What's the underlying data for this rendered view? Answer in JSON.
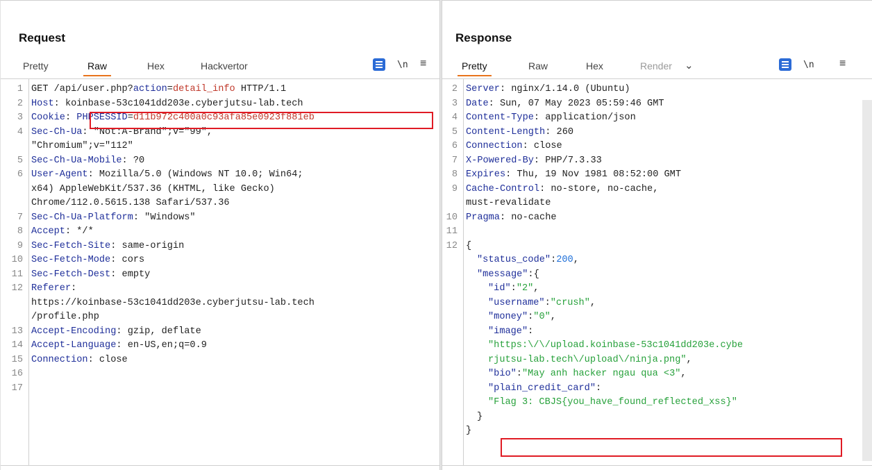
{
  "request": {
    "title": "Request",
    "tabs": [
      "Pretty",
      "Raw",
      "Hex",
      "Hackvertor"
    ],
    "active_tab": "Raw",
    "tool_newline": "\\n",
    "lines": [
      {
        "n": "1",
        "segs": [
          {
            "t": "GET /api/user.php?",
            "c": ""
          },
          {
            "t": "action",
            "c": "key"
          },
          {
            "t": "=",
            "c": ""
          },
          {
            "t": "detail_info",
            "c": "qv"
          },
          {
            "t": " HTTP/1.1",
            "c": ""
          }
        ]
      },
      {
        "n": "2",
        "segs": [
          {
            "t": "Host",
            "c": "key"
          },
          {
            "t": ": koinbase-53c1041dd203e.cyberjutsu-lab.tech",
            "c": ""
          }
        ]
      },
      {
        "n": "3",
        "segs": [
          {
            "t": "Cookie",
            "c": "key"
          },
          {
            "t": ": ",
            "c": ""
          },
          {
            "t": "PHPSESSID",
            "c": "key"
          },
          {
            "t": "=",
            "c": ""
          },
          {
            "t": "d11b972c400a0c93afa85e0923f881eb",
            "c": "qv"
          }
        ]
      },
      {
        "n": "4",
        "segs": [
          {
            "t": "Sec-Ch-Ua",
            "c": "key"
          },
          {
            "t": ": \"Not:A-Brand\";v=\"99\",",
            "c": ""
          }
        ]
      },
      {
        "n": "",
        "segs": [
          {
            "t": "\"Chromium\";v=\"112\"",
            "c": ""
          }
        ]
      },
      {
        "n": "5",
        "segs": [
          {
            "t": "Sec-Ch-Ua-Mobile",
            "c": "key"
          },
          {
            "t": ": ?0",
            "c": ""
          }
        ]
      },
      {
        "n": "6",
        "segs": [
          {
            "t": "User-Agent",
            "c": "key"
          },
          {
            "t": ": Mozilla/5.0 (Windows NT 10.0; Win64;",
            "c": ""
          }
        ]
      },
      {
        "n": "",
        "segs": [
          {
            "t": "x64) AppleWebKit/537.36 (KHTML, like Gecko)",
            "c": ""
          }
        ]
      },
      {
        "n": "",
        "segs": [
          {
            "t": "Chrome/112.0.5615.138 Safari/537.36",
            "c": ""
          }
        ]
      },
      {
        "n": "7",
        "segs": [
          {
            "t": "Sec-Ch-Ua-Platform",
            "c": "key"
          },
          {
            "t": ": \"Windows\"",
            "c": ""
          }
        ]
      },
      {
        "n": "8",
        "segs": [
          {
            "t": "Accept",
            "c": "key"
          },
          {
            "t": ": */*",
            "c": ""
          }
        ]
      },
      {
        "n": "9",
        "segs": [
          {
            "t": "Sec-Fetch-Site",
            "c": "key"
          },
          {
            "t": ": same-origin",
            "c": ""
          }
        ]
      },
      {
        "n": "10",
        "segs": [
          {
            "t": "Sec-Fetch-Mode",
            "c": "key"
          },
          {
            "t": ": cors",
            "c": ""
          }
        ]
      },
      {
        "n": "11",
        "segs": [
          {
            "t": "Sec-Fetch-Dest",
            "c": "key"
          },
          {
            "t": ": empty",
            "c": ""
          }
        ]
      },
      {
        "n": "12",
        "segs": [
          {
            "t": "Referer",
            "c": "key"
          },
          {
            "t": ":",
            "c": ""
          }
        ]
      },
      {
        "n": "",
        "segs": [
          {
            "t": "https://koinbase-53c1041dd203e.cyberjutsu-lab.tech",
            "c": ""
          }
        ]
      },
      {
        "n": "",
        "segs": [
          {
            "t": "/profile.php",
            "c": ""
          }
        ]
      },
      {
        "n": "13",
        "segs": [
          {
            "t": "Accept-Encoding",
            "c": "key"
          },
          {
            "t": ": gzip, deflate",
            "c": ""
          }
        ]
      },
      {
        "n": "14",
        "segs": [
          {
            "t": "Accept-Language",
            "c": "key"
          },
          {
            "t": ": en-US,en;q=0.9",
            "c": ""
          }
        ]
      },
      {
        "n": "15",
        "segs": [
          {
            "t": "Connection",
            "c": "key"
          },
          {
            "t": ": close",
            "c": ""
          }
        ]
      },
      {
        "n": "16",
        "segs": []
      },
      {
        "n": "17",
        "segs": []
      }
    ]
  },
  "response": {
    "title": "Response",
    "tabs": [
      "Pretty",
      "Raw",
      "Hex",
      "Render"
    ],
    "active_tab": "Pretty",
    "disabled_tab": "Render",
    "tool_newline": "\\n",
    "lines": [
      {
        "n": "2",
        "segs": [
          {
            "t": "Server",
            "c": "key"
          },
          {
            "t": ": nginx/1.14.0 (Ubuntu)",
            "c": ""
          }
        ]
      },
      {
        "n": "3",
        "segs": [
          {
            "t": "Date",
            "c": "key"
          },
          {
            "t": ": Sun, 07 May 2023 05:59:46 GMT",
            "c": ""
          }
        ]
      },
      {
        "n": "4",
        "segs": [
          {
            "t": "Content-Type",
            "c": "key"
          },
          {
            "t": ": application/json",
            "c": ""
          }
        ]
      },
      {
        "n": "5",
        "segs": [
          {
            "t": "Content-Length",
            "c": "key"
          },
          {
            "t": ": 260",
            "c": ""
          }
        ]
      },
      {
        "n": "6",
        "segs": [
          {
            "t": "Connection",
            "c": "key"
          },
          {
            "t": ": close",
            "c": ""
          }
        ]
      },
      {
        "n": "7",
        "segs": [
          {
            "t": "X-Powered-By",
            "c": "key"
          },
          {
            "t": ": PHP/7.3.33",
            "c": ""
          }
        ]
      },
      {
        "n": "8",
        "segs": [
          {
            "t": "Expires",
            "c": "key"
          },
          {
            "t": ": Thu, 19 Nov 1981 08:52:00 GMT",
            "c": ""
          }
        ]
      },
      {
        "n": "9",
        "segs": [
          {
            "t": "Cache-Control",
            "c": "key"
          },
          {
            "t": ": no-store, no-cache,",
            "c": ""
          }
        ]
      },
      {
        "n": "",
        "segs": [
          {
            "t": "must-revalidate",
            "c": ""
          }
        ]
      },
      {
        "n": "10",
        "segs": [
          {
            "t": "Pragma",
            "c": "key"
          },
          {
            "t": ": no-cache",
            "c": ""
          }
        ]
      },
      {
        "n": "11",
        "segs": []
      },
      {
        "n": "12",
        "segs": [
          {
            "t": "{",
            "c": ""
          }
        ]
      },
      {
        "n": "",
        "ind": 1,
        "segs": [
          {
            "t": "\"status_code\"",
            "c": "jkey"
          },
          {
            "t": ":",
            "c": ""
          },
          {
            "t": "200",
            "c": "jnum"
          },
          {
            "t": ",",
            "c": ""
          }
        ]
      },
      {
        "n": "",
        "ind": 1,
        "segs": [
          {
            "t": "\"message\"",
            "c": "jkey"
          },
          {
            "t": ":{",
            "c": ""
          }
        ]
      },
      {
        "n": "",
        "ind": 2,
        "segs": [
          {
            "t": "\"id\"",
            "c": "jkey"
          },
          {
            "t": ":",
            "c": ""
          },
          {
            "t": "\"2\"",
            "c": "jstr"
          },
          {
            "t": ",",
            "c": ""
          }
        ]
      },
      {
        "n": "",
        "ind": 2,
        "segs": [
          {
            "t": "\"username\"",
            "c": "jkey"
          },
          {
            "t": ":",
            "c": ""
          },
          {
            "t": "\"crush\"",
            "c": "jstr"
          },
          {
            "t": ",",
            "c": ""
          }
        ]
      },
      {
        "n": "",
        "ind": 2,
        "segs": [
          {
            "t": "\"money\"",
            "c": "jkey"
          },
          {
            "t": ":",
            "c": ""
          },
          {
            "t": "\"0\"",
            "c": "jstr"
          },
          {
            "t": ",",
            "c": ""
          }
        ]
      },
      {
        "n": "",
        "ind": 2,
        "segs": [
          {
            "t": "\"image\"",
            "c": "jkey"
          },
          {
            "t": ":",
            "c": ""
          }
        ]
      },
      {
        "n": "",
        "ind": 2,
        "segs": [
          {
            "t": "\"https:\\/\\/upload.koinbase-53c1041dd203e.cybe",
            "c": "jstr"
          }
        ]
      },
      {
        "n": "",
        "ind": 2,
        "segs": [
          {
            "t": "rjutsu-lab.tech\\/upload\\/ninja.png\"",
            "c": "jstr"
          },
          {
            "t": ",",
            "c": ""
          }
        ]
      },
      {
        "n": "",
        "ind": 2,
        "segs": [
          {
            "t": "\"bio\"",
            "c": "jkey"
          },
          {
            "t": ":",
            "c": ""
          },
          {
            "t": "\"May anh hacker ngau qua <3\"",
            "c": "jstr"
          },
          {
            "t": ",",
            "c": ""
          }
        ]
      },
      {
        "n": "",
        "ind": 2,
        "segs": [
          {
            "t": "\"plain_credit_card\"",
            "c": "jkey"
          },
          {
            "t": ":",
            "c": ""
          }
        ]
      },
      {
        "n": "",
        "ind": 2,
        "segs": [
          {
            "t": "\"Flag 3: CBJS{you_have_found_reflected_xss}\"",
            "c": "jstr"
          }
        ]
      },
      {
        "n": "",
        "ind": 1,
        "segs": [
          {
            "t": "}",
            "c": ""
          }
        ]
      },
      {
        "n": "",
        "segs": [
          {
            "t": "}",
            "c": ""
          }
        ]
      }
    ]
  },
  "colors": {
    "accent_tab_underline": "#e8741c",
    "toolbar_blue": "#2b6bd6",
    "highlight_box": "#e01b24",
    "header_key": "#1f2f9a",
    "query_value": "#c0392b",
    "json_string": "#27a13b",
    "json_number": "#1e6fd9"
  }
}
